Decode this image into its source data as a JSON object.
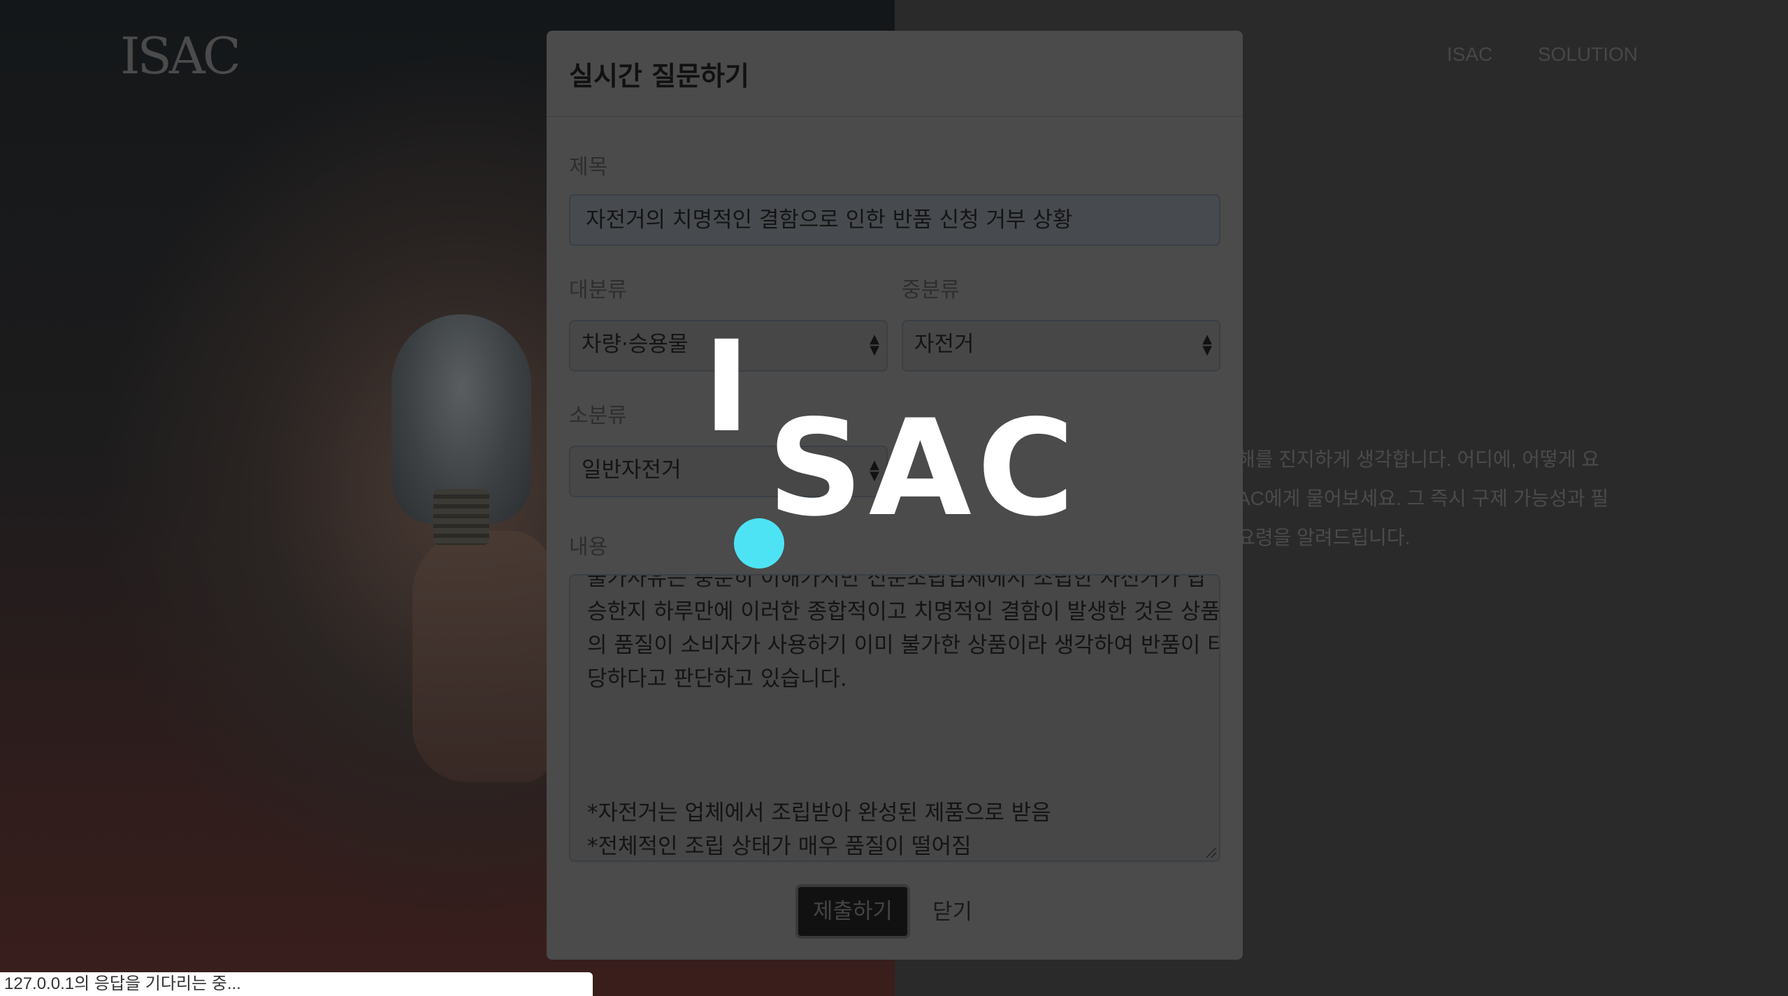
{
  "background": {
    "logo_text": "ISAC",
    "nav": {
      "isac": "ISAC",
      "solution": "SOLUTION"
    },
    "paragraph_lines": [
      "해를 진지하게 생각합니다. 어디에, 어떻게 요",
      "AC에게 물어보세요. 그 즉시 구제 가능성과 필",
      "요령을 알려드립니다."
    ]
  },
  "modal": {
    "title": "실시간 질문하기",
    "title_label": "제목",
    "title_value": "자전거의 치명적인 결함으로 인한 반품 신청 거부 상황",
    "major_label": "대분류",
    "major_value": "차량·승용물",
    "middle_label": "중분류",
    "middle_value": "자전거",
    "minor_label": "소분류",
    "minor_value": "일반자전거",
    "content_label": "내용",
    "content_lines": [
      "불가사유는 충분히 이해가지만 전문조립업체에서 조립한 자전거가 탑",
      "승한지 하루만에 이러한 종합적이고 치명적인 결함이 발생한 것은 상품",
      "의 품질이 소비자가 사용하기 이미 불가한 상품이라 생각하여 반품이 타",
      "당하다고 판단하고 있습니다.",
      "*자전거는 업체에서 조립받아 완성된 제품으로 받음",
      "*전체적인 조립 상태가 매우 품질이 떨어짐"
    ],
    "submit_label": "제출하기",
    "close_label": "닫기"
  },
  "overlay_logo": {
    "first": "I",
    "rest": "SAC"
  },
  "status_bar": {
    "text": "127.0.0.1의 응답을 기다리는 중..."
  },
  "colors": {
    "logo_dot": "#4de3f5",
    "modal_bg": "#4b4b4b"
  }
}
